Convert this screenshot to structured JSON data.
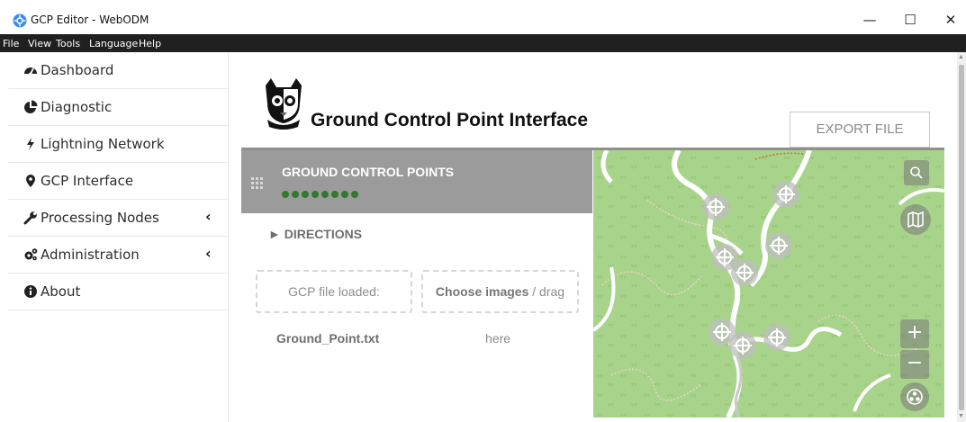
{
  "window": {
    "title": "GCP Editor - WebODM",
    "minimize": "—",
    "maximize": "☐",
    "close": "✕"
  },
  "menu": [
    "File",
    "View",
    "Tools",
    "Language",
    "Help"
  ],
  "sidebar": {
    "items": [
      {
        "label": "Dashboard",
        "icon": "tachometer-icon"
      },
      {
        "label": "Diagnostic",
        "icon": "pie-chart-icon"
      },
      {
        "label": "Lightning Network",
        "icon": "bolt-icon"
      },
      {
        "label": "GCP Interface",
        "icon": "map-marker-icon"
      },
      {
        "label": "Processing Nodes",
        "icon": "wrench-icon",
        "caret": "‹"
      },
      {
        "label": "Administration",
        "icon": "cogs-icon",
        "caret": "‹"
      },
      {
        "label": "About",
        "icon": "info-icon"
      }
    ]
  },
  "header": {
    "title": "Ground Control Point Interface",
    "export_label": "EXPORT FILE"
  },
  "gcp": {
    "title": "GROUND CONTROL POINTS",
    "dot_count": 8,
    "directions": "► DIRECTIONS",
    "file_box_label": "GCP file loaded:",
    "file_name": "Ground_Point.txt",
    "choose_bold": "Choose images",
    "choose_rest": " / drag",
    "choose_here": "here"
  },
  "map": {
    "zoom_in": "+",
    "zoom_out": "−",
    "marker_count": 8
  },
  "colors": {
    "menubar": "#202020",
    "map_green": "#a8d38b",
    "dot_green": "#2f7a2f",
    "panel_gray": "#9b9b9b"
  }
}
